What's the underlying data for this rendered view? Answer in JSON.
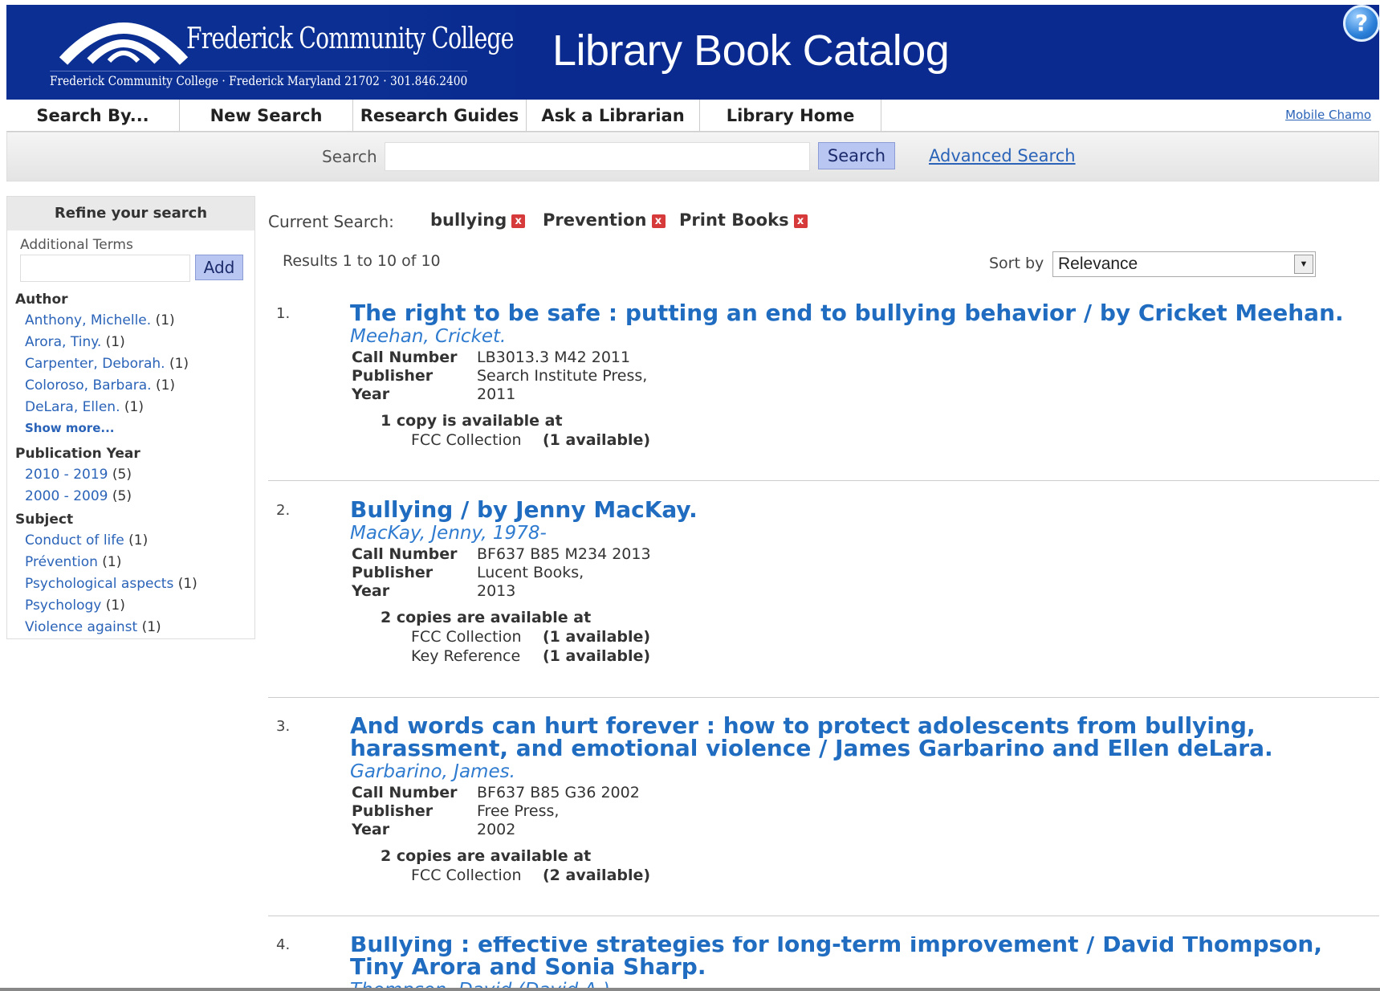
{
  "header": {
    "college_name": "Frederick Community College",
    "college_address": "Frederick Community College · Frederick Maryland 21702 · 301.846.2400",
    "site_title": "Library Book Catalog",
    "help_label": "?"
  },
  "nav": {
    "items": [
      "Search By...",
      "New Search",
      "Research Guides",
      "Ask a Librarian",
      "Library Home Page"
    ],
    "mobile_link": "Mobile Chamo"
  },
  "search": {
    "label": "Search",
    "value": "",
    "button": "Search",
    "advanced": "Advanced Search"
  },
  "sidebar": {
    "title": "Refine your search",
    "additional_terms_label": "Additional Terms",
    "add_button": "Add",
    "author": {
      "title": "Author",
      "items": [
        {
          "label": "Anthony, Michelle.",
          "count": "(1)"
        },
        {
          "label": "Arora, Tiny.",
          "count": "(1)"
        },
        {
          "label": "Carpenter, Deborah.",
          "count": "(1)"
        },
        {
          "label": "Coloroso, Barbara.",
          "count": "(1)"
        },
        {
          "label": "DeLara, Ellen.",
          "count": "(1)"
        }
      ],
      "show_more": "Show more..."
    },
    "year": {
      "title": "Publication Year",
      "items": [
        {
          "label": "2010 - 2019",
          "count": "(5)"
        },
        {
          "label": "2000 - 2009",
          "count": "(5)"
        }
      ]
    },
    "subject": {
      "title": "Subject",
      "items": [
        {
          "label": "Conduct of life",
          "count": "(1)"
        },
        {
          "label": "Prévention",
          "count": "(1)"
        },
        {
          "label": "Psychological aspects",
          "count": "(1)"
        },
        {
          "label": "Psychology",
          "count": "(1)"
        },
        {
          "label": "Violence against",
          "count": "(1)"
        }
      ]
    }
  },
  "main": {
    "current_search_label": "Current Search:",
    "chips": [
      "bullying",
      "Prevention",
      "Print Books"
    ],
    "chip_remove": "x",
    "results_count": "Results 1 to 10 of 10",
    "sort_label": "Sort by",
    "sort_value": "Relevance",
    "sort_arrow": "▼",
    "meta_keys": {
      "call": "Call Number",
      "publisher": "Publisher",
      "year": "Year"
    },
    "results": [
      {
        "num": "1.",
        "title": "The right to be safe : putting an end to bullying behavior / by Cricket Meehan.",
        "author": "Meehan, Cricket.",
        "call": "LB3013.3 M42 2011",
        "publisher": "Search Institute Press,",
        "year": "2011",
        "avail_head": "1 copy is available at",
        "holdings": [
          {
            "loc": "FCC Collection",
            "status": "(1 available)"
          }
        ]
      },
      {
        "num": "2.",
        "title": "Bullying / by Jenny MacKay.",
        "author": "MacKay, Jenny, 1978-",
        "call": "BF637 B85 M234 2013",
        "publisher": "Lucent Books,",
        "year": "2013",
        "avail_head": "2 copies are available at",
        "holdings": [
          {
            "loc": "FCC Collection",
            "status": "(1 available)"
          },
          {
            "loc": "Key Reference",
            "status": "(1 available)"
          }
        ]
      },
      {
        "num": "3.",
        "title": "And words can hurt forever : how to protect adolescents from bullying, harassment, and emotional violence / James Garbarino and Ellen deLara.",
        "author": "Garbarino, James.",
        "call": "BF637 B85 G36 2002",
        "publisher": "Free Press,",
        "year": "2002",
        "avail_head": "2 copies are available at",
        "holdings": [
          {
            "loc": "FCC Collection",
            "status": "(2 available)"
          }
        ]
      },
      {
        "num": "4.",
        "title": "Bullying : effective strategies for long-term improvement / David Thompson, Tiny Arora and Sonia Sharp.",
        "author": "Thompson, David (David A.)"
      }
    ]
  }
}
